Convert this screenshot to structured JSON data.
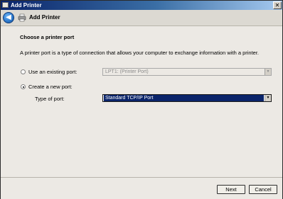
{
  "window": {
    "title": "Add Printer",
    "close_glyph": "✕"
  },
  "header": {
    "title": "Add Printer",
    "back_glyph": "◀"
  },
  "content": {
    "heading": "Choose a printer port",
    "description": "A printer port is a type of connection that allows your computer to exchange information with a printer.",
    "existing_port": {
      "label": "Use an existing port:",
      "value": "LPT1: (Printer Port)",
      "selected": false
    },
    "new_port": {
      "label": "Create a new port:",
      "selected": true,
      "type_label": "Type of port:",
      "type_value": "Standard TCP/IP Port"
    },
    "dropdown_glyph": "▼"
  },
  "footer": {
    "next_label": "Next",
    "cancel_label": "Cancel"
  },
  "icons": {
    "back": "back-arrow-icon",
    "printer": "printer-icon",
    "dropdown": "chevron-down-icon"
  }
}
